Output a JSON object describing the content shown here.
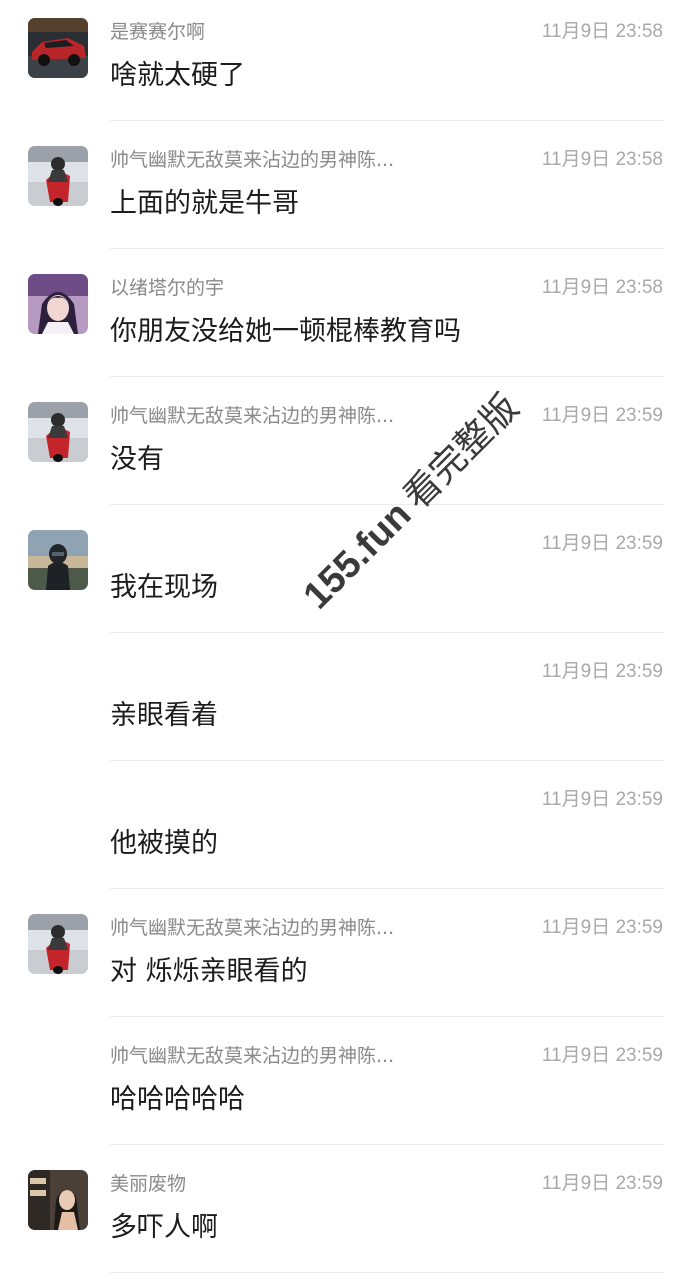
{
  "messages": [
    {
      "name": "是赛赛尔啊",
      "time": "11月9日 23:58",
      "text": "啥就太硬了",
      "avatar": "red-sports-car-avatar"
    },
    {
      "name": "帅气幽默无敌莫来沾边的男神陈...",
      "time": "11月9日 23:58",
      "text": "上面的就是牛哥",
      "avatar": "motorcycle-rider-avatar"
    },
    {
      "name": "以绪塔尔的宇",
      "time": "11月9日 23:58",
      "text": "你朋友没给她一顿棍棒教育吗",
      "avatar": "anime-girl-avatar"
    },
    {
      "name": "帅气幽默无敌莫来沾边的男神陈...",
      "time": "11月9日 23:59",
      "text": "没有",
      "avatar": "motorcycle-rider-avatar"
    },
    {
      "name": "",
      "time": "11月9日 23:59",
      "text": "我在现场",
      "avatar": "helmet-rider-avatar"
    },
    {
      "name": "",
      "time": "11月9日 23:59",
      "text": "亲眼看着",
      "avatar": ""
    },
    {
      "name": "",
      "time": "11月9日 23:59",
      "text": "他被摸的",
      "avatar": ""
    },
    {
      "name": "帅气幽默无敌莫来沾边的男神陈...",
      "time": "11月9日 23:59",
      "text": "对 烁烁亲眼看的",
      "avatar": "motorcycle-rider-avatar"
    },
    {
      "name": "帅气幽默无敌莫来沾边的男神陈...",
      "time": "11月9日 23:59",
      "text": "哈哈哈哈哈",
      "avatar": ""
    },
    {
      "name": "美丽废物",
      "time": "11月9日 23:59",
      "text": "多吓人啊",
      "avatar": "girl-photo-avatar"
    }
  ],
  "watermark": {
    "site": "155.fun",
    "label": "看完整版"
  },
  "colors": {
    "name": "#8a8a8a",
    "time": "#a9a9a9",
    "text": "#1c1c1c",
    "divider": "#ececec",
    "accent": "#e03a3a"
  }
}
